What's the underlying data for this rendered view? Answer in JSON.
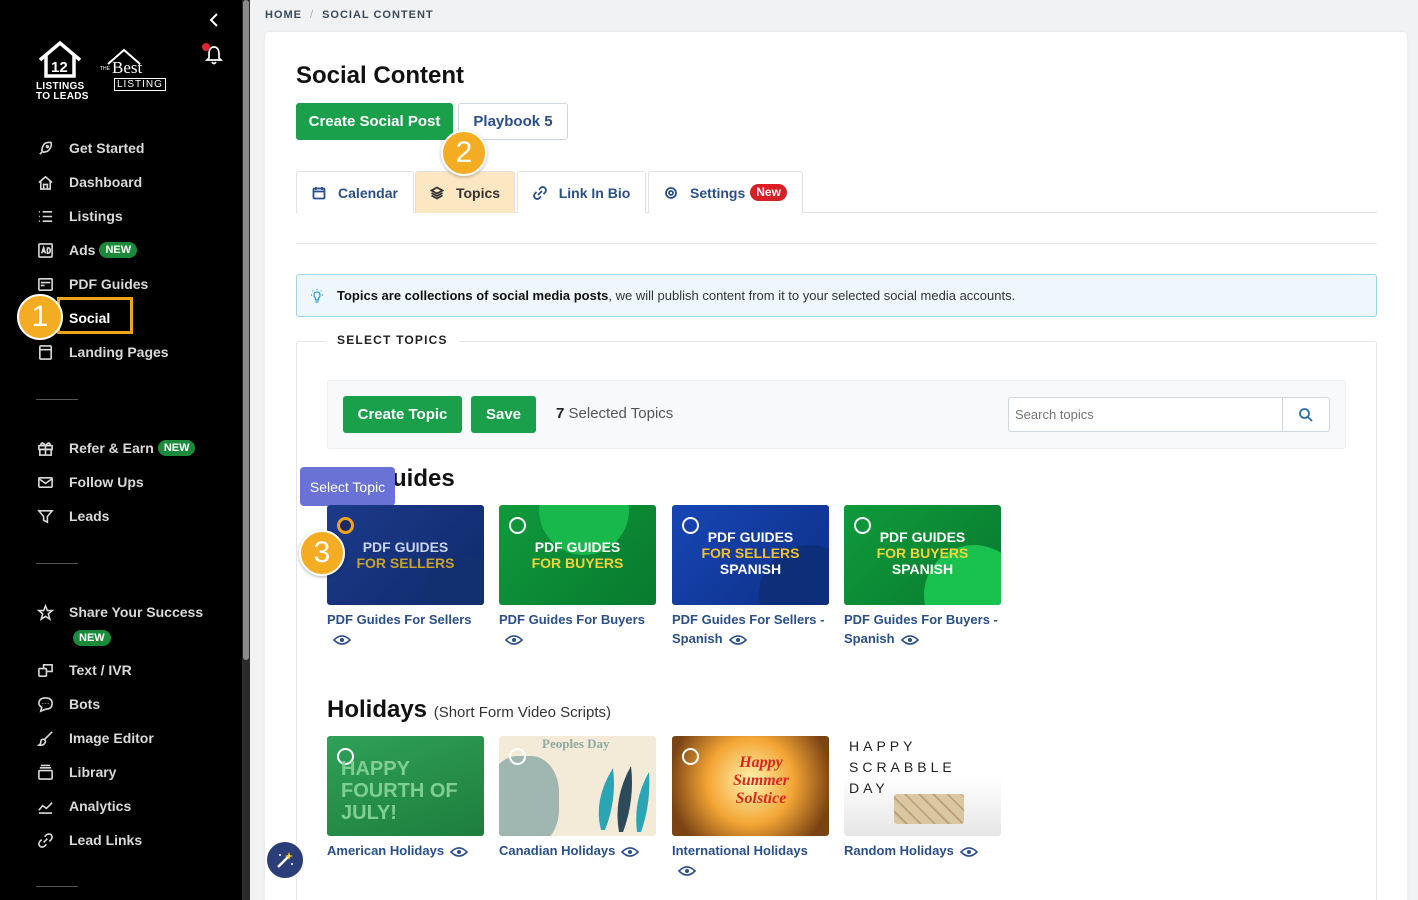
{
  "sidebar": {
    "logo_text_1": "LISTINGS TO LEADS",
    "logo_best": "Best",
    "logo_the": "THE",
    "logo_listing": "LISTING",
    "items": [
      {
        "label": "Get Started",
        "icon": "rocket-icon"
      },
      {
        "label": "Dashboard",
        "icon": "home-icon"
      },
      {
        "label": "Listings",
        "icon": "list-icon"
      },
      {
        "label": "Ads",
        "icon": "ad-icon",
        "badge": "NEW"
      },
      {
        "label": "PDF Guides",
        "icon": "pdf-icon"
      },
      {
        "label": "Social",
        "icon": "social-icon"
      },
      {
        "label": "Landing Pages",
        "icon": "landing-page-icon"
      },
      {
        "label": "Refer & Earn",
        "icon": "gift-icon",
        "badge": "NEW"
      },
      {
        "label": "Follow Ups",
        "icon": "mail-icon"
      },
      {
        "label": "Leads",
        "icon": "filter-icon"
      },
      {
        "label": "Share Your Success",
        "icon": "star-icon",
        "badge": "NEW"
      },
      {
        "label": "Text / IVR",
        "icon": "chat-icon"
      },
      {
        "label": "Bots",
        "icon": "bot-icon"
      },
      {
        "label": "Image Editor",
        "icon": "brush-icon"
      },
      {
        "label": "Library",
        "icon": "library-icon"
      },
      {
        "label": "Analytics",
        "icon": "analytics-icon"
      },
      {
        "label": "Lead Links",
        "icon": "link-icon"
      }
    ]
  },
  "steps": [
    "1",
    "2",
    "3"
  ],
  "breadcrumb": {
    "home": "HOME",
    "sep": "/",
    "current": "SOCIAL CONTENT"
  },
  "page": {
    "title": "Social Content",
    "create_post": "Create Social Post",
    "playbook": "Playbook 5"
  },
  "tabs": [
    {
      "label": "Calendar",
      "icon": "calendar-icon"
    },
    {
      "label": "Topics",
      "icon": "layers-icon",
      "active": true
    },
    {
      "label": "Link In Bio",
      "icon": "link-icon"
    },
    {
      "label": "Settings",
      "icon": "gear-icon",
      "badge": "New"
    }
  ],
  "info": {
    "bold": "Topics are collections of social media posts",
    "rest": ", we will publish content from it to your selected social media accounts."
  },
  "select": {
    "legend": "SELECT TOPICS",
    "create_topic": "Create Topic",
    "save": "Save",
    "count": "7",
    "count_label": " Selected Topics",
    "search_placeholder": "Search topics"
  },
  "tooltip": "Select Topic",
  "groups": [
    {
      "title": "PDF Guides",
      "title_visible": "uides",
      "topics": [
        {
          "thumb": "PDF GUIDES FOR SELLERS",
          "line1": "PDF GUIDES",
          "line2": "FOR SELLERS",
          "caption": "PDF Guides For Sellers"
        },
        {
          "thumb": "PDF GUIDES FOR BUYERS",
          "line1": "PDF GUIDES",
          "line2": "FOR BUYERS",
          "caption": "PDF Guides For Buyers"
        },
        {
          "line1": "PDF GUIDES",
          "line2": "FOR SELLERS",
          "line3": "SPANISH",
          "caption": "PDF Guides For Sellers - Spanish"
        },
        {
          "line1": "PDF GUIDES",
          "line2": "FOR BUYERS",
          "line3": "SPANISH",
          "caption": "PDF Guides For Buyers - Spanish"
        }
      ]
    },
    {
      "title": "Holidays",
      "subtitle": "(Short Form Video Scripts)",
      "topics": [
        {
          "thumb_text": "HAPPY FOURTH OF JULY!",
          "caption": "American Holidays"
        },
        {
          "thumb_text": "Peoples Day",
          "caption": "Canadian Holidays"
        },
        {
          "thumb_text": "Happy Summer Solstice",
          "caption": "International Holidays"
        },
        {
          "thumb_text": "HAPPY SCRABBLE DAY",
          "caption": "Random Holidays"
        }
      ]
    }
  ],
  "colors": {
    "green": "#1aa04a",
    "accent": "#f4ad22",
    "link": "#2a4f8a"
  }
}
